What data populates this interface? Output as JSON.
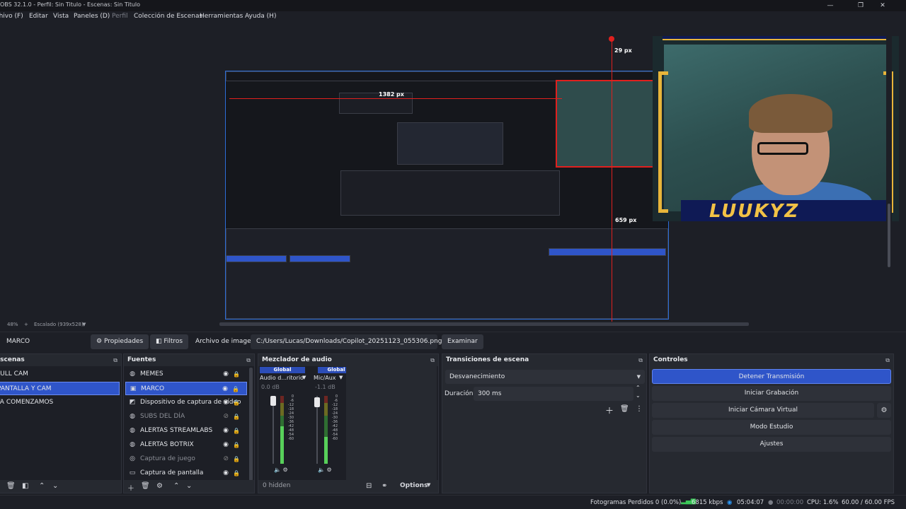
{
  "window": {
    "title": "OBS 32.1.0 - Perfil: Sin Titulo - Escenas: Sin Titulo",
    "minimize": "—",
    "maximize": "❐",
    "close": "✕"
  },
  "menu": [
    "Archivo (F)",
    "Editar",
    "Vista",
    "Paneles (D)",
    "Perfil",
    "Colección de Escenas",
    "Herramientas",
    "Ayuda (H)"
  ],
  "preview": {
    "measure_left": "1382 px",
    "measure_top": "29 px",
    "measure_bottom": "659 px",
    "cam_name": "LUUKYZ",
    "zoom": "48%",
    "zoom_add": "+",
    "scale_label": "Escalado (939x528)",
    "dropdown": "▼"
  },
  "context": {
    "source_name": "MARCO",
    "properties": "Propiedades",
    "filters": "Filtros",
    "image_file_label": "Archivo de imagen",
    "image_path": "C:/Users/Lucas/Downloads/Copilot_20251123_055306.png",
    "browse": "Examinar"
  },
  "scenes": {
    "title": "Escenas",
    "items": [
      "FULL CAM",
      "PANTALLA Y CAM",
      "YA COMENZAMOS"
    ],
    "selected_index": 1
  },
  "sources": {
    "title": "Fuentes",
    "items": [
      {
        "label": "MEMES",
        "icon": "globe-icon",
        "glyph": "◍",
        "visible": true,
        "dim": false
      },
      {
        "label": "MARCO",
        "icon": "image-icon",
        "glyph": "▣",
        "visible": true,
        "dim": false,
        "selected": true
      },
      {
        "label": "Dispositivo de captura de vídeo",
        "icon": "camera-icon",
        "glyph": "◩",
        "visible": true,
        "dim": false
      },
      {
        "label": "SUBS DEL DÍA",
        "icon": "globe-icon",
        "glyph": "◍",
        "visible": false,
        "dim": true
      },
      {
        "label": "ALERTAS STREAMLABS",
        "icon": "globe-icon",
        "glyph": "◍",
        "visible": true,
        "dim": false
      },
      {
        "label": "ALERTAS BOTRIX",
        "icon": "globe-icon",
        "glyph": "◍",
        "visible": true,
        "dim": false
      },
      {
        "label": "Captura de juego",
        "icon": "gamepad-icon",
        "glyph": "◎",
        "visible": false,
        "dim": true
      },
      {
        "label": "Captura de pantalla",
        "icon": "monitor-icon",
        "glyph": "▭",
        "visible": true,
        "dim": false
      }
    ]
  },
  "mixer": {
    "title": "Mezclador de audio",
    "channels": [
      {
        "global": "Global",
        "name": "Audio d...ritorio",
        "db": "0.0 dB",
        "level": 0.55
      },
      {
        "global": "Global",
        "name": "Mic/Aux",
        "db": "-1.1 dB",
        "level": 0.4
      }
    ],
    "scale": [
      "0",
      "-6",
      "-12",
      "-18",
      "-24",
      "-30",
      "-36",
      "-42",
      "-48",
      "-54",
      "-60"
    ],
    "hidden": "0 hidden",
    "options": "Options"
  },
  "transitions": {
    "title": "Transiciones de escena",
    "selected": "Desvanecimiento",
    "duration_label": "Duración",
    "duration_value": "300 ms"
  },
  "controls": {
    "title": "Controles",
    "buttons": [
      "Detener Transmisión",
      "Iniciar Grabación",
      "Iniciar Cámara Virtual",
      "Modo Estudio",
      "Ajustes"
    ]
  },
  "status": {
    "dropped": "Fotogramas Perdidos 0 (0.0%)",
    "bitrate": "6815 kbps",
    "stream_time": "05:04:07",
    "rec_time": "00:00:00",
    "cpu": "CPU: 1.6%",
    "fps": "60.00 / 60.00 FPS"
  },
  "colors": {
    "accent": "#2f55c9",
    "live": "#2d9cff",
    "bitrate_ok": "#3cc95a",
    "measure_line": "#e0201e",
    "brand_gold": "#e8b53a"
  }
}
